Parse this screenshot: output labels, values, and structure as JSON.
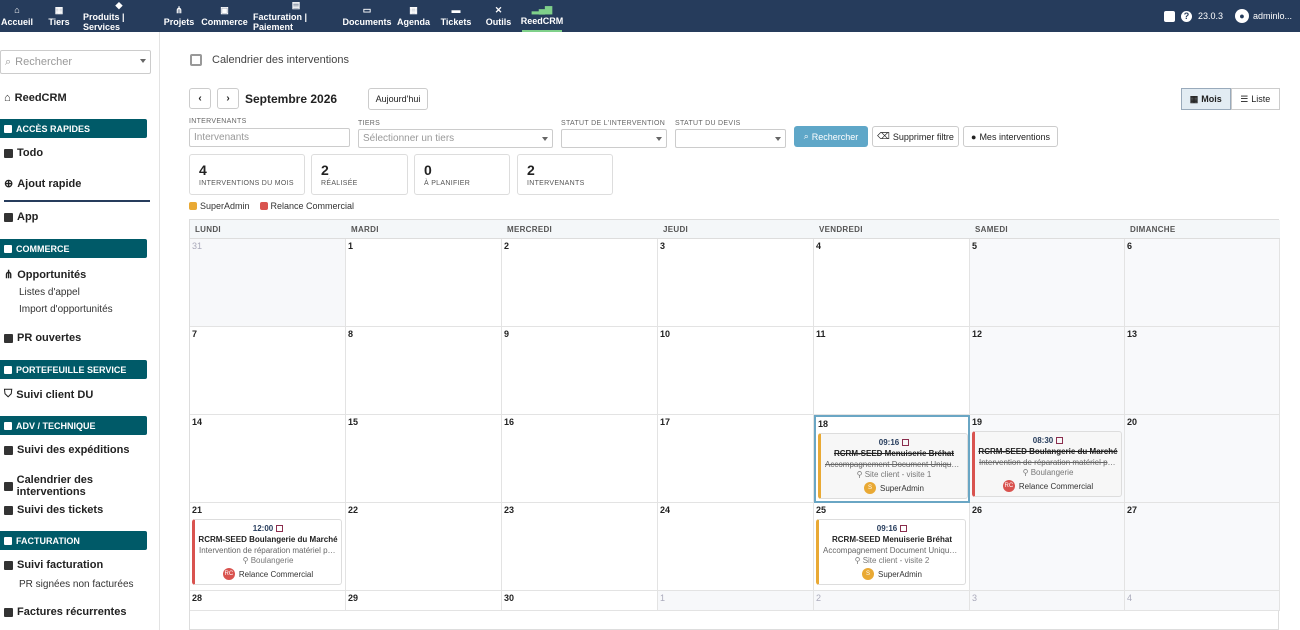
{
  "nav": {
    "items": [
      {
        "label": "Accueil",
        "icon": "home-icon"
      },
      {
        "label": "Tiers",
        "icon": "building-icon"
      },
      {
        "label": "Produits | Services",
        "icon": "cube-icon"
      },
      {
        "label": "Projets",
        "icon": "sitemap-icon"
      },
      {
        "label": "Commerce",
        "icon": "briefcase-icon"
      },
      {
        "label": "Facturation | Paiement",
        "icon": "file-invoice-icon"
      },
      {
        "label": "Documents",
        "icon": "folder-icon"
      },
      {
        "label": "Agenda",
        "icon": "calendar-icon"
      },
      {
        "label": "Tickets",
        "icon": "ticket-icon"
      },
      {
        "label": "Outils",
        "icon": "tools-icon"
      },
      {
        "label": "ReedCRM",
        "icon": "signal-icon"
      }
    ],
    "version": "23.0.3",
    "user": "adminlo..."
  },
  "sidebar": {
    "search_placeholder": "Rechercher",
    "reedcrm": "ReedCRM",
    "acces_rapides": "ACCÈS RAPIDES",
    "todo": "Todo",
    "ajout_rapide": "Ajout rapide",
    "app": "App",
    "commerce": "COMMERCE",
    "opportunites": "Opportunités",
    "listes_appel": "Listes d'appel",
    "import_opp": "Import d'opportunités",
    "pr_ouvertes": "PR ouvertes",
    "portefeuille": "PORTEFEUILLE SERVICE",
    "suivi_client": "Suivi client DU",
    "adv": "ADV / TECHNIQUE",
    "suivi_expeditions": "Suivi des expéditions",
    "calendrier": "Calendrier des interventions",
    "suivi_tickets": "Suivi des tickets",
    "facturation": "FACTURATION",
    "suivi_facturation": "Suivi facturation",
    "pr_signees": "PR signées non facturées",
    "factures_rec": "Factures récurrentes"
  },
  "page": {
    "title": "Calendrier des interventions",
    "month": "Septembre 2026",
    "today": "Aujourd'hui",
    "view_month": "Mois",
    "view_list": "Liste"
  },
  "filters": {
    "intervenants_label": "INTERVENANTS",
    "intervenants_placeholder": "Intervenants",
    "tiers_label": "TIERS",
    "tiers_placeholder": "Sélectionner un tiers",
    "statut_intervention_label": "STATUT DE L'INTERVENTION",
    "statut_devis_label": "STATUT DU DEVIS",
    "search": "Rechercher",
    "clear": "Supprimer filtre",
    "mine": "Mes interventions"
  },
  "stats": [
    {
      "value": "4",
      "label": "INTERVENTIONS DU MOIS"
    },
    {
      "value": "2",
      "label": "RÉALISÉE"
    },
    {
      "value": "0",
      "label": "À PLANIFIER"
    },
    {
      "value": "2",
      "label": "INTERVENANTS"
    }
  ],
  "legend": [
    {
      "label": "SuperAdmin",
      "color": "#e9a934"
    },
    {
      "label": "Relance Commercial",
      "color": "#d9534f"
    }
  ],
  "calendar": {
    "weekdays": [
      "LUNDI",
      "MARDI",
      "MERCREDI",
      "JEUDI",
      "VENDREDI",
      "SAMEDI",
      "DIMANCHE"
    ],
    "weeks": [
      [
        "31",
        "1",
        "2",
        "3",
        "4",
        "5",
        "6"
      ],
      [
        "7",
        "8",
        "9",
        "10",
        "11",
        "12",
        "13"
      ],
      [
        "14",
        "15",
        "16",
        "17",
        "18",
        "19",
        "20"
      ],
      [
        "21",
        "22",
        "23",
        "24",
        "25",
        "26",
        "27"
      ],
      [
        "28",
        "29",
        "30",
        "1",
        "2",
        "3",
        "4"
      ]
    ],
    "events": [
      {
        "week": 2,
        "day": 4,
        "time": "09:16",
        "title": "RCRM-SEED Menuiserie Bréhat",
        "desc": "Accompagnement Document Unique - f...",
        "loc": "Site client - visite 1",
        "user": "SuperAdmin",
        "initials": "S",
        "type": "sa",
        "done": true
      },
      {
        "week": 2,
        "day": 5,
        "time": "08:30",
        "title": "RCRM-SEED Boulangerie du Marché",
        "desc": "Intervention de réparation matériel phy...",
        "loc": "Boulangerie",
        "user": "Relance Commercial",
        "initials": "RC",
        "type": "rc",
        "done": true
      },
      {
        "week": 3,
        "day": 0,
        "time": "12:00",
        "title": "RCRM-SEED Boulangerie du Marché",
        "desc": "Intervention de réparation matériel phy...",
        "loc": "Boulangerie",
        "user": "Relance Commercial",
        "initials": "RC",
        "type": "rc",
        "done": false
      },
      {
        "week": 3,
        "day": 4,
        "time": "09:16",
        "title": "RCRM-SEED Menuiserie Bréhat",
        "desc": "Accompagnement Document Unique - f...",
        "loc": "Site client - visite 2",
        "user": "SuperAdmin",
        "initials": "S",
        "type": "sa",
        "done": false
      }
    ]
  }
}
